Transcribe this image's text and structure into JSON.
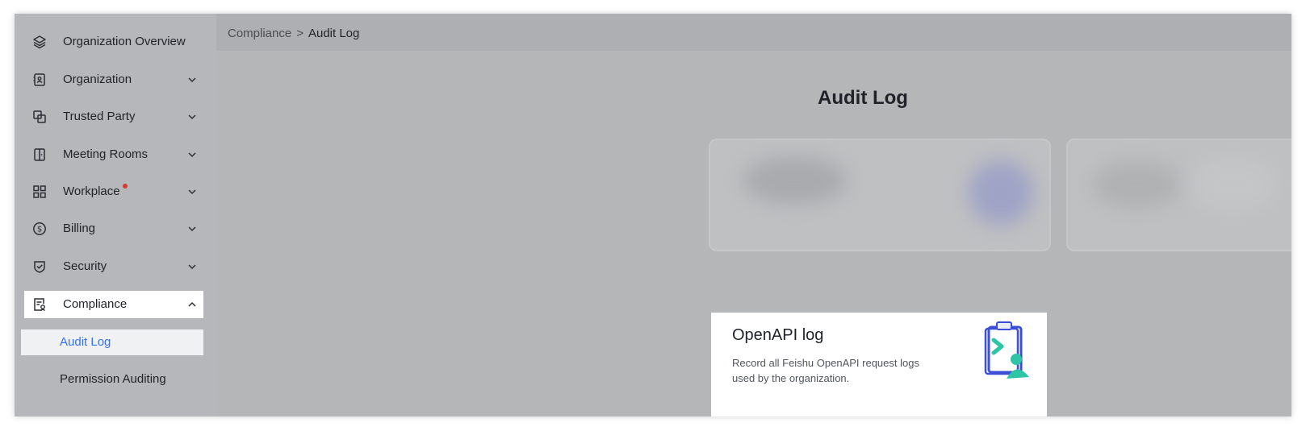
{
  "sidebar": {
    "items": [
      {
        "label": "Organization Overview",
        "icon": "layers-icon"
      },
      {
        "label": "Organization",
        "icon": "contact-card-icon"
      },
      {
        "label": "Trusted Party",
        "icon": "link-squares-icon"
      },
      {
        "label": "Meeting Rooms",
        "icon": "door-icon"
      },
      {
        "label": "Workplace",
        "icon": "grid-icon",
        "badge": "red-dot"
      },
      {
        "label": "Billing",
        "icon": "dollar-circle-icon"
      },
      {
        "label": "Security",
        "icon": "shield-check-icon"
      },
      {
        "label": "Compliance",
        "icon": "compliance-doc-icon",
        "expanded": true
      }
    ],
    "subitems": [
      {
        "label": "Audit Log",
        "active": true
      },
      {
        "label": "Permission Auditing"
      }
    ]
  },
  "breadcrumb": {
    "parent": "Compliance",
    "separator": ">",
    "current": "Audit Log"
  },
  "main": {
    "title": "Audit Log",
    "card": {
      "title": "OpenAPI log",
      "description": "Record all Feishu OpenAPI request logs used by the organization.",
      "icon": "clipboard-api-illustration"
    }
  },
  "colors": {
    "accent": "#3370ff",
    "badge": "#d33a31",
    "overlay": "#b5b6b8"
  }
}
